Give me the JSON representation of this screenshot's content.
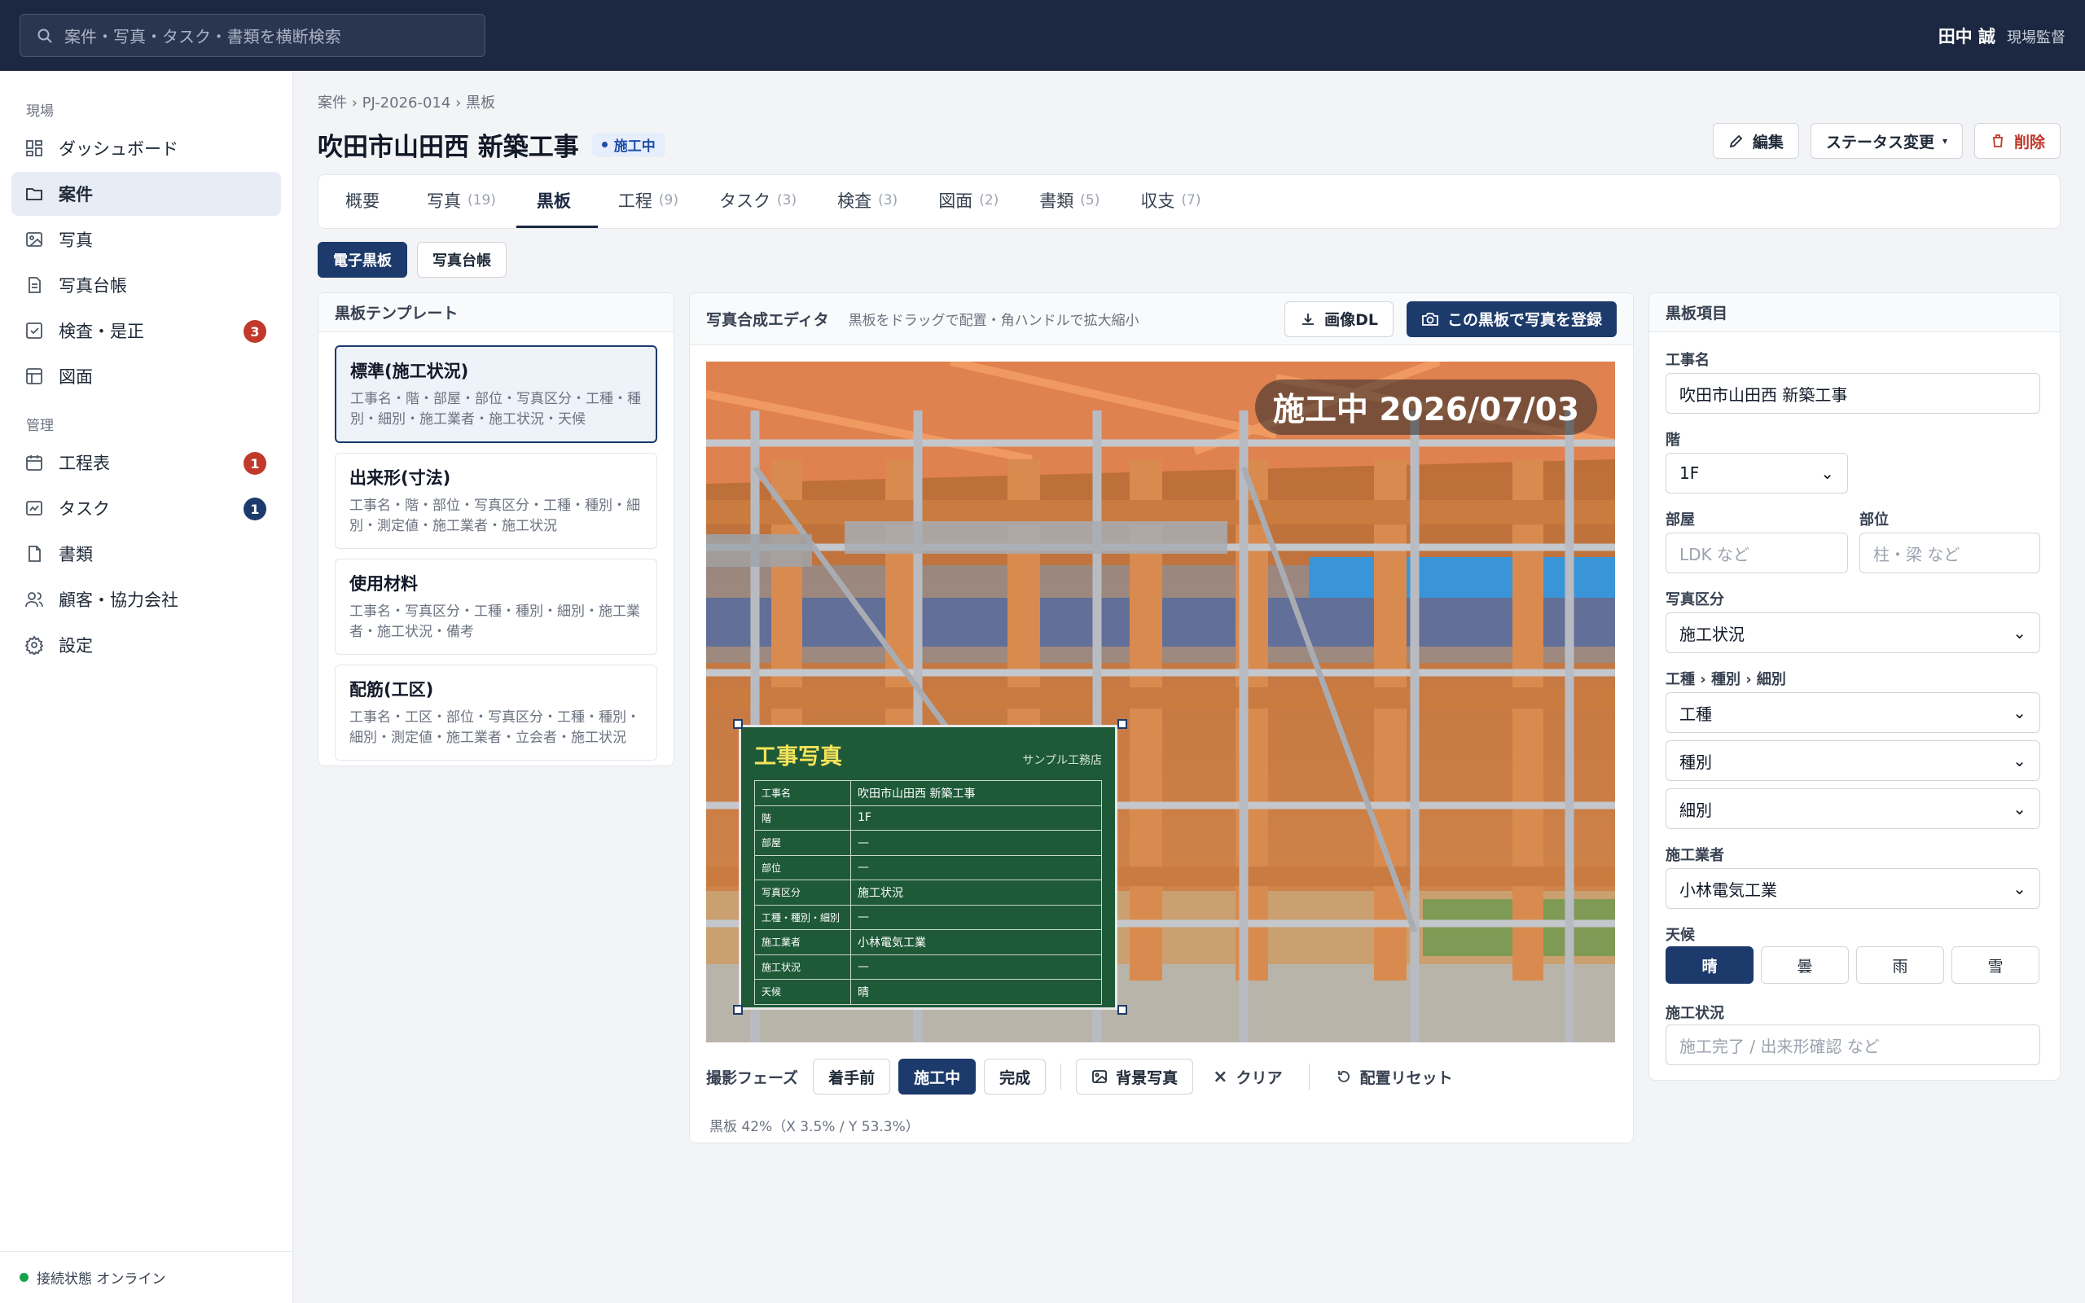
{
  "header": {
    "search_placeholder": "案件・写真・タスク・書類を横断検索",
    "user_name": "田中 誠",
    "user_role": "現場監督"
  },
  "sidebar": {
    "section_site": "現場",
    "section_manage": "管理",
    "items": [
      {
        "label": "ダッシュボード",
        "icon": "dashboard-icon"
      },
      {
        "label": "案件",
        "icon": "folder-icon",
        "active": true
      },
      {
        "label": "写真",
        "icon": "image-icon"
      },
      {
        "label": "写真台帳",
        "icon": "document-icon"
      },
      {
        "label": "検査・是正",
        "icon": "checkbox-icon",
        "badge": "3"
      },
      {
        "label": "図面",
        "icon": "layout-icon"
      },
      {
        "label": "工程表",
        "icon": "calendar-icon",
        "badge": "1"
      },
      {
        "label": "タスク",
        "icon": "task-icon",
        "badge": "1"
      },
      {
        "label": "書類",
        "icon": "file-icon"
      },
      {
        "label": "顧客・協力会社",
        "icon": "users-icon"
      },
      {
        "label": "設定",
        "icon": "gear-icon"
      }
    ],
    "connection": "接続状態 オンライン"
  },
  "breadcrumb": {
    "a": "案件",
    "b": "PJ-2026-014",
    "c": "黒板"
  },
  "project": {
    "title": "吹田市山田西 新築工事",
    "status": "施工中"
  },
  "actions": {
    "edit": "編集",
    "status_change": "ステータス変更",
    "delete": "削除"
  },
  "tabs": [
    {
      "label": "概要",
      "count": ""
    },
    {
      "label": "写真",
      "count": "(19)"
    },
    {
      "label": "黒板",
      "count": "",
      "active": true
    },
    {
      "label": "工程",
      "count": "(9)"
    },
    {
      "label": "タスク",
      "count": "(3)"
    },
    {
      "label": "検査",
      "count": "(3)"
    },
    {
      "label": "図面",
      "count": "(2)"
    },
    {
      "label": "書類",
      "count": "(5)"
    },
    {
      "label": "収支",
      "count": "(7)"
    }
  ],
  "subtabs": {
    "a": "電子黒板",
    "b": "写真台帳"
  },
  "templates": {
    "title": "黒板テンプレート",
    "items": [
      {
        "name": "標準(施工状況)",
        "desc": "工事名・階・部屋・部位・写真区分・工種・種別・細別・施工業者・施工状況・天候"
      },
      {
        "name": "出来形(寸法)",
        "desc": "工事名・階・部位・写真区分・工種・種別・細別・測定値・施工業者・施工状況"
      },
      {
        "name": "使用材料",
        "desc": "工事名・写真区分・工種・種別・細別・施工業者・施工状況・備考"
      },
      {
        "name": "配筋(工区)",
        "desc": "工事名・工区・部位・写真区分・工種・種別・細別・測定値・施工業者・立会者・施工状況"
      }
    ]
  },
  "editor": {
    "title": "写真合成エディタ",
    "hint": "黒板をドラッグで配置・角ハンドルで拡大縮小",
    "download": "画像DL",
    "register": "この黒板で写真を登録",
    "stamp": "施工中 2026/07/03",
    "board_title": "工事写真",
    "board_company": "サンプル工務店",
    "board_rows": [
      {
        "k": "工事名",
        "v": "吹田市山田西 新築工事"
      },
      {
        "k": "階",
        "v": "1F"
      },
      {
        "k": "部屋",
        "v": "—"
      },
      {
        "k": "部位",
        "v": "—"
      },
      {
        "k": "写真区分",
        "v": "施工状況"
      },
      {
        "k": "工種・種別・細別",
        "v": "—"
      },
      {
        "k": "施工業者",
        "v": "小林電気工業"
      },
      {
        "k": "施工状況",
        "v": "—"
      },
      {
        "k": "天候",
        "v": "晴"
      }
    ],
    "phase_label": "撮影フェーズ",
    "phases": [
      "着手前",
      "施工中",
      "完成"
    ],
    "bg_photo": "背景写真",
    "clear": "クリア",
    "reset": "配置リセット",
    "info": "黒板 42%（X 3.5% / Y 53.3%）"
  },
  "fields": {
    "title": "黒板項目",
    "name_label": "工事名",
    "name_value": "吹田市山田西 新築工事",
    "floor_label": "階",
    "floor_value": "1F",
    "room_label": "部屋",
    "room_placeholder": "LDK など",
    "part_label": "部位",
    "part_placeholder": "柱・梁 など",
    "category_label": "写真区分",
    "category_value": "施工状況",
    "work_label": "工種 › 種別 › 細別",
    "work_type": "工種",
    "work_kind": "種別",
    "work_detail": "細別",
    "contractor_label": "施工業者",
    "contractor_value": "小林電気工業",
    "weather_label": "天候",
    "weather": [
      "晴",
      "曇",
      "雨",
      "雪"
    ],
    "status_label": "施工状況",
    "status_placeholder": "施工完了 / 出来形確認 など"
  },
  "colors": {
    "navy": "#1c2841",
    "accent": "#1c3a6b",
    "danger": "#c0392b",
    "board": "#1e5a38"
  }
}
